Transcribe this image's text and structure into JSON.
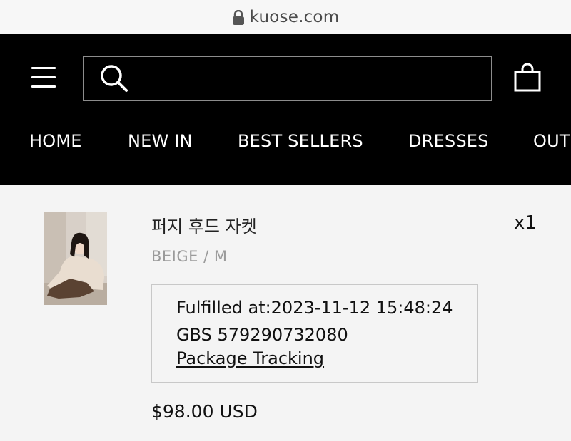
{
  "browser": {
    "url": "kuose.com",
    "icon": "lock-icon"
  },
  "header": {
    "search": {
      "placeholder": "",
      "value": ""
    },
    "nav": [
      "HOME",
      "NEW IN",
      "BEST SELLERS",
      "DRESSES",
      "OUT"
    ]
  },
  "order_item": {
    "name": "퍼지 후드 자켓",
    "variant": "BEIGE / M",
    "quantity": "x1",
    "fulfillment": {
      "fulfilled_at": "Fulfilled at:2023-11-12 15:48:24",
      "tracking_number": "GBS 579290732080",
      "tracking_link": "Package Tracking"
    },
    "price": "$98.00 USD"
  },
  "colors": {
    "header_bg": "#000000",
    "page_bg": "#f4f4f4",
    "variant_text": "#9a9a9a"
  }
}
